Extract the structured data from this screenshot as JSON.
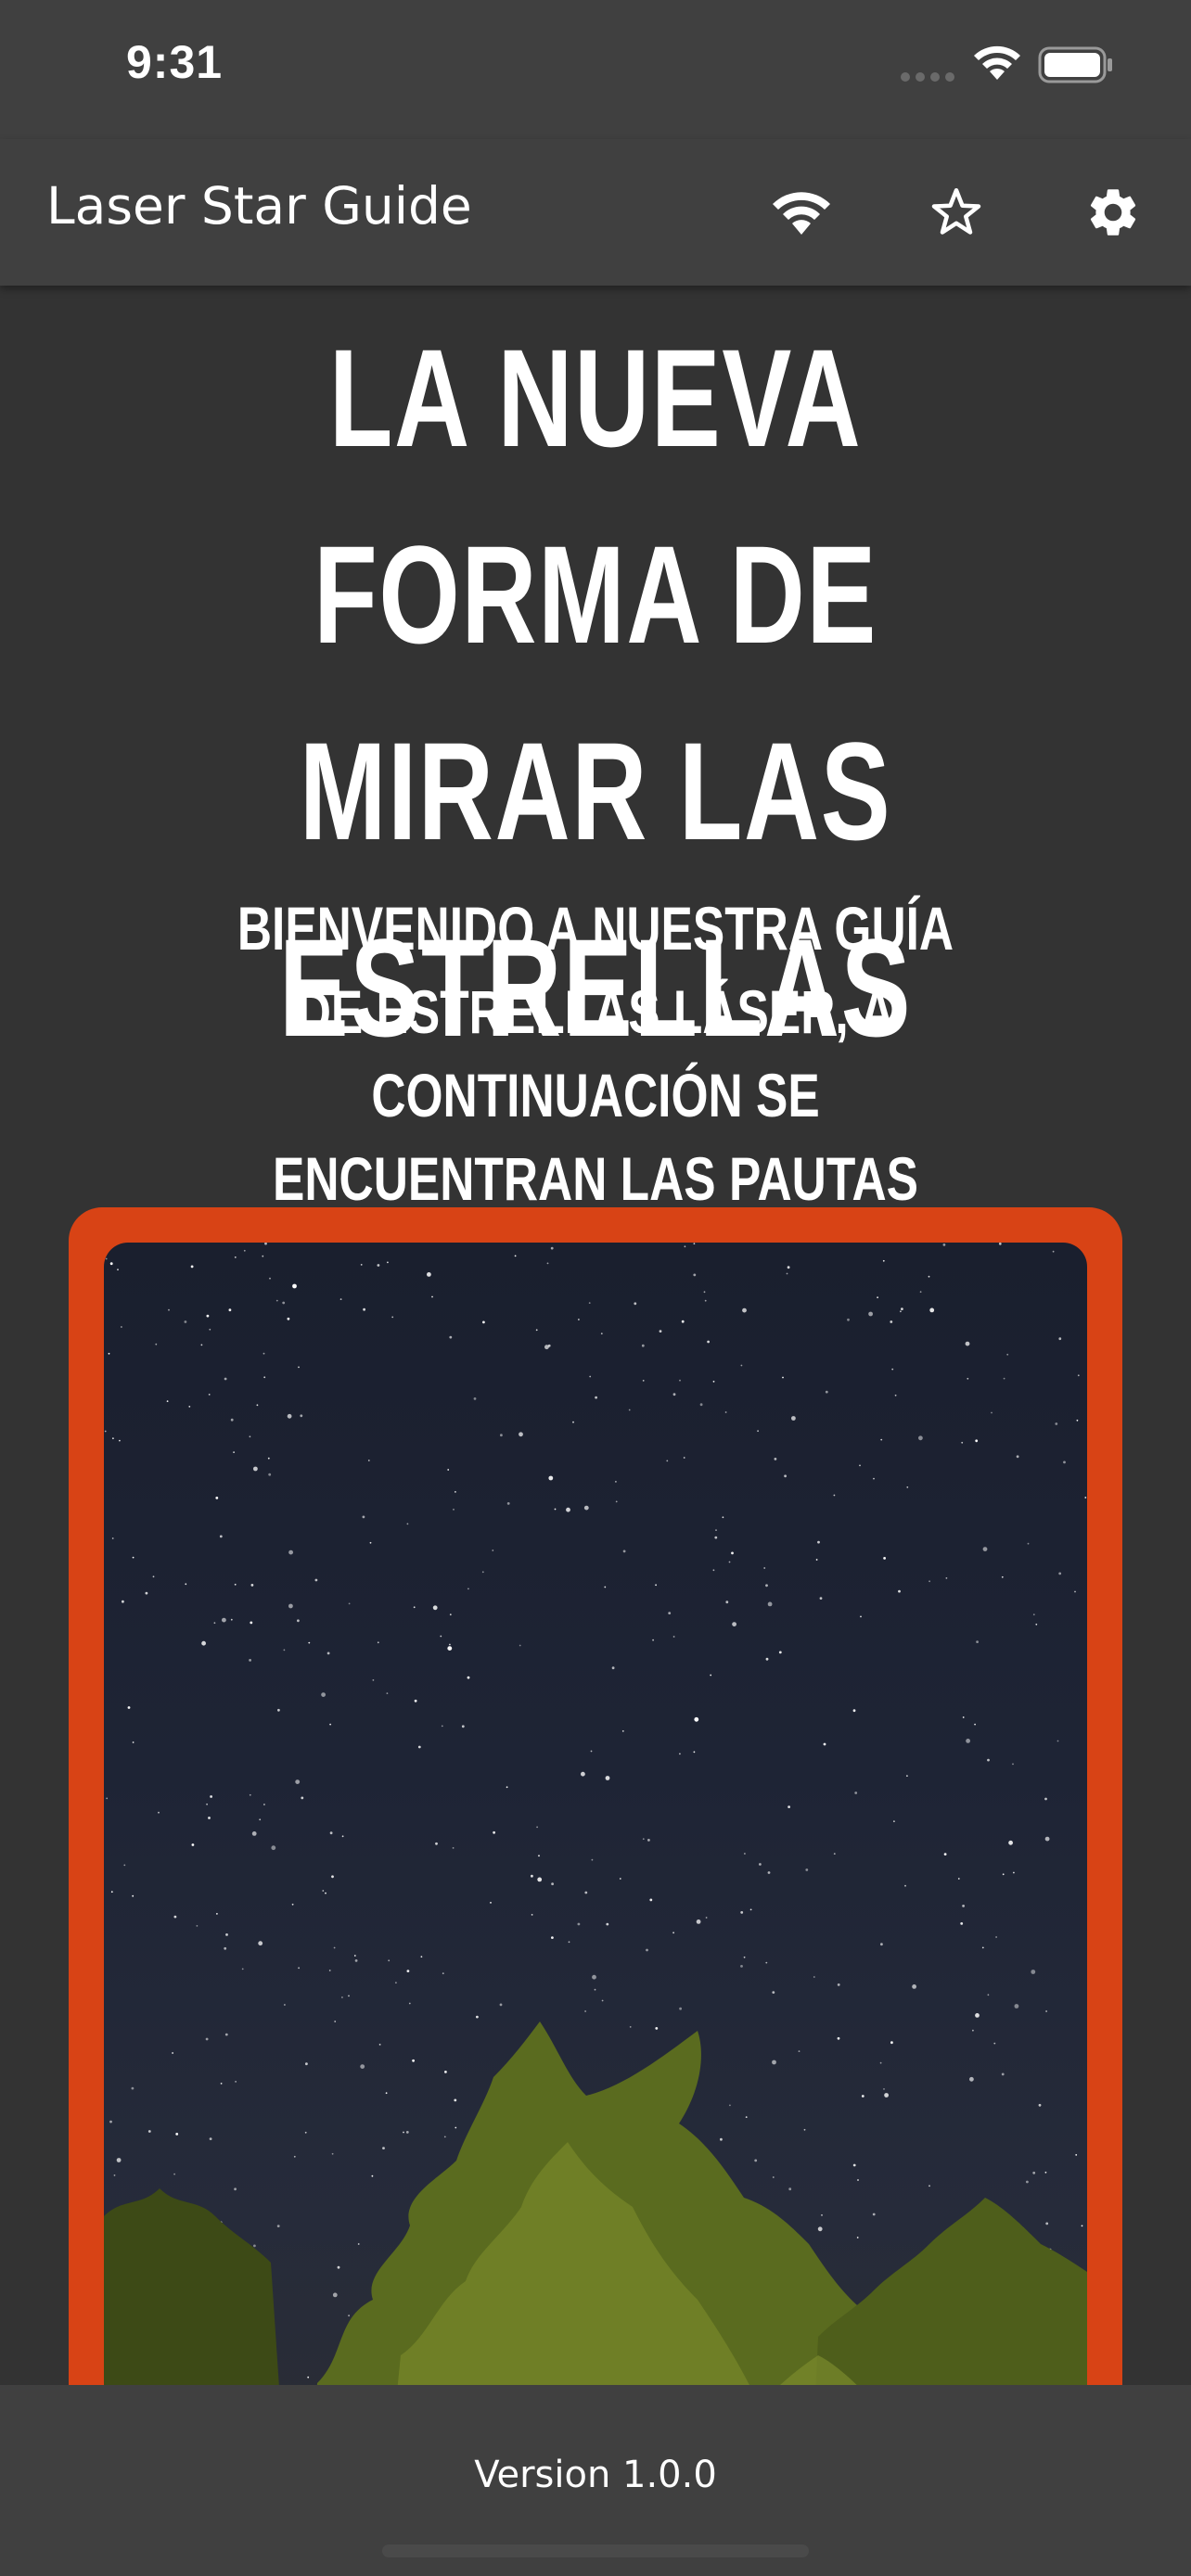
{
  "status_bar": {
    "time": "9:31"
  },
  "app_bar": {
    "title": "Laser Star Guide",
    "icons": [
      "wifi-icon",
      "star-outline-icon",
      "gear-icon"
    ]
  },
  "hero": {
    "title": "LA NUEVA FORMA DE MIRAR LAS ESTRELLAS",
    "subtitle": "BIENVENIDO A NUESTRA GUÍA DE ESTRELLAS LÁSER, A CONTINUACIÓN SE ENCUENTRAN LAS PAUTAS GENERALES."
  },
  "photo": {
    "subject": "starry-night-sky-with-trees",
    "frame_color": "#d84315"
  },
  "footer": {
    "version": "Version 1.0.0"
  },
  "colors": {
    "background": "#333333",
    "bar": "#404040",
    "accent": "#d84315",
    "text": "#ffffff"
  }
}
